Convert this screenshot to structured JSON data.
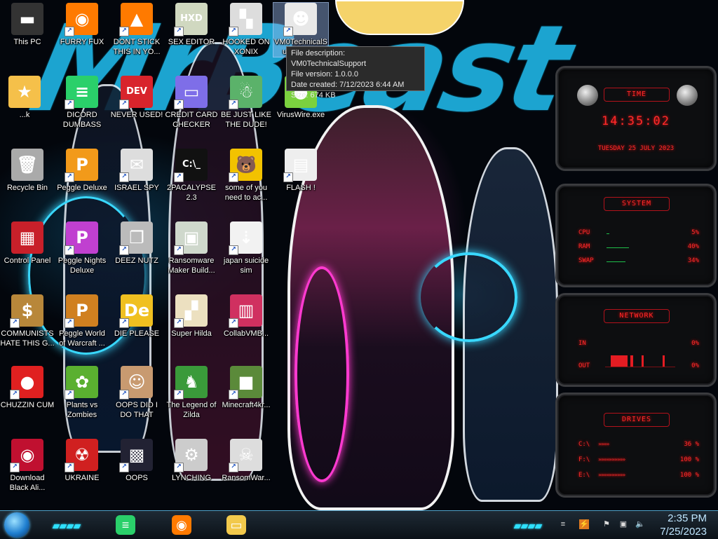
{
  "wallpaper": {
    "brush_text": "MrBeast"
  },
  "desktop": {
    "icons": [
      {
        "id": "this-pc",
        "label": "This PC",
        "shortcut": false,
        "glyph": "▬",
        "color": "#333"
      },
      {
        "id": "furry-fux",
        "label": "FURRY FUX",
        "shortcut": true,
        "glyph": "◉",
        "color": "#ff7a00"
      },
      {
        "id": "dont-stick",
        "label": "DONT STICK THIS IN YO...",
        "shortcut": true,
        "glyph": "▲",
        "color": "#ff7a00"
      },
      {
        "id": "sex-editor",
        "label": "SEX EDITOR",
        "shortcut": true,
        "glyph": "HXD",
        "color": "#d0d8c0"
      },
      {
        "id": "hooked-on-xonix",
        "label": "HOOKED ON XONIX",
        "shortcut": true,
        "glyph": "▚",
        "color": "#ddd"
      },
      {
        "id": "vm0-technical-support",
        "label": "VM0TechnicalSupport.exe",
        "shortcut": true,
        "glyph": "☻",
        "color": "#e8e8e8"
      },
      {
        "id": "dick",
        "label": "...k",
        "shortcut": false,
        "glyph": "★",
        "color": "#f5c04a"
      },
      {
        "id": "dicord-dumbass",
        "label": "DICORD DUMBASS",
        "shortcut": true,
        "glyph": "≡",
        "color": "#2ad06a"
      },
      {
        "id": "never-used",
        "label": "NEVER USED!",
        "shortcut": true,
        "glyph": "DEV",
        "color": "#d8242c"
      },
      {
        "id": "credit-card-checker",
        "label": "CREDIT CARD CHECKER",
        "shortcut": true,
        "glyph": "▭",
        "color": "#7e6ee8"
      },
      {
        "id": "be-just-like-the-dude",
        "label": "BE JUST LIKE THE DUDE!",
        "shortcut": true,
        "glyph": "☃",
        "color": "#5bb26a"
      },
      {
        "id": "viruswire",
        "label": "VirusWire.exe",
        "shortcut": false,
        "glyph": "●",
        "color": "#7bd13f"
      },
      {
        "id": "recycle-bin",
        "label": "Recycle Bin",
        "shortcut": false,
        "glyph": "🗑",
        "color": "#aaa"
      },
      {
        "id": "peggle-deluxe",
        "label": "Peggle Deluxe",
        "shortcut": true,
        "glyph": "P",
        "color": "#f29a1a"
      },
      {
        "id": "israel-spy",
        "label": "ISRAEL SPY",
        "shortcut": true,
        "glyph": "✉",
        "color": "#ddd"
      },
      {
        "id": "2pacalypse",
        "label": "2PACALYPSE 2.3",
        "shortcut": true,
        "glyph": "C:\\_",
        "color": "#111"
      },
      {
        "id": "some-of-you",
        "label": "some of you need to ac...",
        "shortcut": true,
        "glyph": "🐻",
        "color": "#f2c200"
      },
      {
        "id": "flash",
        "label": "FLASH !",
        "shortcut": true,
        "glyph": "▤",
        "color": "#eee"
      },
      {
        "id": "control-panel",
        "label": "Control Panel",
        "shortcut": false,
        "glyph": "▦",
        "color": "#c8202a"
      },
      {
        "id": "peggle-nights",
        "label": "Peggle Nights Deluxe",
        "shortcut": true,
        "glyph": "P",
        "color": "#c040d0"
      },
      {
        "id": "deez-nutz",
        "label": "DEEZ NUTZ",
        "shortcut": true,
        "glyph": "❐",
        "color": "#bbb"
      },
      {
        "id": "ransomware-maker",
        "label": "Ransomware Maker Build...",
        "shortcut": true,
        "glyph": "▣",
        "color": "#cfd8cc"
      },
      {
        "id": "japan-suicide-sim",
        "label": "japan suicide sim",
        "shortcut": true,
        "glyph": "⇣",
        "color": "#f2f2f2"
      },
      {
        "id": "communists",
        "label": "COMMUNISTS HATE THIS G...",
        "shortcut": true,
        "glyph": "$",
        "color": "#b8873a"
      },
      {
        "id": "peggle-world",
        "label": "Peggle World of Warcraft ...",
        "shortcut": true,
        "glyph": "P",
        "color": "#d08020"
      },
      {
        "id": "die-please",
        "label": "DIE PLEASE",
        "shortcut": true,
        "glyph": "De",
        "color": "#f0c020"
      },
      {
        "id": "super-hilda",
        "label": "Super Hilda",
        "shortcut": true,
        "glyph": "▞",
        "color": "#ece0c0"
      },
      {
        "id": "collabvmb",
        "label": "CollabVMB...",
        "shortcut": true,
        "glyph": "▥",
        "color": "#d03060"
      },
      {
        "id": "chuzzin-cum",
        "label": "CHUZZIN CUM",
        "shortcut": true,
        "glyph": "●",
        "color": "#e02020"
      },
      {
        "id": "plants-vs-zombies",
        "label": "Plants vs Zombies",
        "shortcut": true,
        "glyph": "✿",
        "color": "#5ab030"
      },
      {
        "id": "oops-did-i",
        "label": "OOPS DID I DO THAT",
        "shortcut": true,
        "glyph": "☺",
        "color": "#c89a70"
      },
      {
        "id": "legend-of-zilda",
        "label": "The Legend of Zilda",
        "shortcut": true,
        "glyph": "♞",
        "color": "#3a9a3a"
      },
      {
        "id": "minecraft4kr",
        "label": "Minecraft4kr...",
        "shortcut": true,
        "glyph": "■",
        "color": "#5b8a3a"
      },
      {
        "id": "download-black-ali",
        "label": "Download Black Ali...",
        "shortcut": true,
        "glyph": "◉",
        "color": "#c01030"
      },
      {
        "id": "ukraine",
        "label": "UKRAINE",
        "shortcut": true,
        "glyph": "☢",
        "color": "#d02020"
      },
      {
        "id": "oops",
        "label": "OOPS",
        "shortcut": true,
        "glyph": "▩",
        "color": "#223"
      },
      {
        "id": "lynching",
        "label": "LYNCHING",
        "shortcut": true,
        "glyph": "⚙",
        "color": "#ccc"
      },
      {
        "id": "ransomwar",
        "label": "RansomWar...",
        "shortcut": true,
        "glyph": "☠",
        "color": "#ddd"
      }
    ]
  },
  "tooltip": {
    "line1": "File description: VM0TechnicalSupport",
    "line2": "File version: 1.0.0.0",
    "line3": "Date created: 7/12/2023 6:44 AM",
    "line4": "Size: 674 KB"
  },
  "widgets": {
    "time": {
      "title": "TIME",
      "clock": "14:35:02",
      "date": "TUESDAY 25 JULY 2023"
    },
    "system": {
      "title": "SYSTEM",
      "rows": [
        {
          "label": "CPU",
          "value": "5%",
          "fraction": 0.05
        },
        {
          "label": "RAM",
          "value": "40%",
          "fraction": 0.4
        },
        {
          "label": "SWAP",
          "value": "34%",
          "fraction": 0.34
        }
      ]
    },
    "network": {
      "title": "NETWORK",
      "rows": [
        {
          "label": "IN",
          "value": "0%"
        },
        {
          "label": "OUT",
          "value": "0%"
        }
      ]
    },
    "drives": {
      "title": "DRIVES",
      "rows": [
        {
          "label": "C:\\",
          "value": "36 %",
          "fraction": 0.36
        },
        {
          "label": "F:\\",
          "value": "100 %",
          "fraction": 1.0
        },
        {
          "label": "E:\\",
          "value": "100 %",
          "fraction": 1.0
        }
      ]
    }
  },
  "taskbar": {
    "pinned": [
      {
        "id": "discord-pinned",
        "glyph": "≡",
        "color": "#2ad06a"
      },
      {
        "id": "firefox-pinned",
        "glyph": "◉",
        "color": "#ff7a00"
      },
      {
        "id": "explorer-pinned",
        "glyph": "▭",
        "color": "#f2c94c"
      }
    ],
    "clock_time": "2:35 PM",
    "clock_date": "7/25/2023"
  }
}
